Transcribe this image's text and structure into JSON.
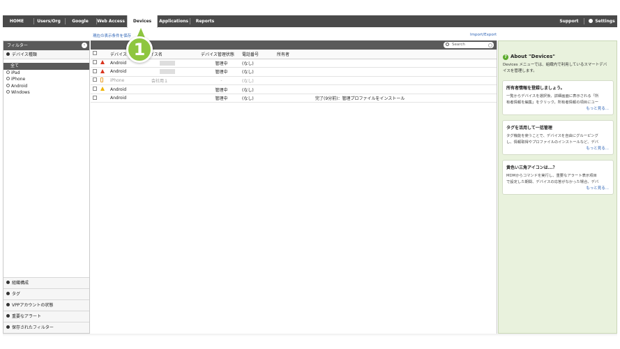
{
  "nav": {
    "tabs": [
      {
        "label": "HOME"
      },
      {
        "label": "Users/Org"
      },
      {
        "label": "Google Apps"
      },
      {
        "label": "Web Access"
      },
      {
        "label": "Devices"
      },
      {
        "label": "Applications"
      },
      {
        "label": "Reports"
      }
    ],
    "support_label": "Support",
    "settings_label": "Settings"
  },
  "subbar": {
    "save_view_label": "現在の表示条件を保存",
    "import_export_label": "Import/Export"
  },
  "filter_panel": {
    "title": "フィルター",
    "device_type_section": "デバイス種類",
    "tree": [
      {
        "label": "全て"
      },
      {
        "label": "iPad"
      },
      {
        "label": "iPhone"
      },
      {
        "label": "Android"
      },
      {
        "label": "Windows"
      }
    ],
    "bottom_sections": [
      {
        "label": "組織構成"
      },
      {
        "label": "タグ"
      },
      {
        "label": "VPPアカウントの状態"
      },
      {
        "label": "重要なアラート"
      },
      {
        "label": "保存されたフィルター"
      }
    ]
  },
  "search": {
    "placeholder": "Search"
  },
  "step_marker": "1",
  "table": {
    "columns": [
      "デバイス",
      "デバイス名",
      "デバイス管理状態",
      "電話番号",
      "所有者"
    ],
    "rows": [
      {
        "device": "Android",
        "name": "",
        "status": "管理中",
        "phone": "(なし)",
        "owner": "",
        "note": "",
        "alert": "red"
      },
      {
        "device": "Android",
        "name": "",
        "status": "管理中",
        "phone": "(なし)",
        "owner": "",
        "note": "",
        "alert": "red"
      },
      {
        "device": "iPhone",
        "name": "会社用１",
        "status": "-",
        "phone": "(なし)",
        "owner": "",
        "note": "",
        "alert": "phone"
      },
      {
        "device": "Android",
        "name": "",
        "status": "管理中",
        "phone": "(なし)",
        "owner": "",
        "note": "",
        "alert": "yellow"
      },
      {
        "device": "Android",
        "name": "",
        "status": "管理中",
        "phone": "(なし)",
        "owner": "",
        "note": "完了(9分前)：管理プロファイルをインストール",
        "alert": "none"
      }
    ]
  },
  "about": {
    "title": "About \"Devices\"",
    "desc_line1": "Devices メニューでは、組織内で利用しているスマートデバ",
    "desc_line2": "イスを管理します。",
    "cards": [
      {
        "title": "所有者情報を登録しましょう。",
        "line1": "一覧からデバイスを選択後、詳細画面に表示される「所",
        "line2": "有者情報を編集」をクリック。所有者情報の項目にユー",
        "more": "もっと見る..."
      },
      {
        "title": "タグを活用して一括管理",
        "line1": "タグ機能を使うことで、デバイスを自由にグルーピング",
        "line2": "し、情報取得やプロファイルのインストールなど、デバ",
        "more": "もっと見る..."
      },
      {
        "title": "黄色い三角アイコンは...？",
        "line1": "MDMからコマンドを実行し、重要なアラート表示項目",
        "line2": "で設定した期間、デバイスの応答がなかった場合、デバ",
        "more": "もっと見る..."
      }
    ]
  }
}
